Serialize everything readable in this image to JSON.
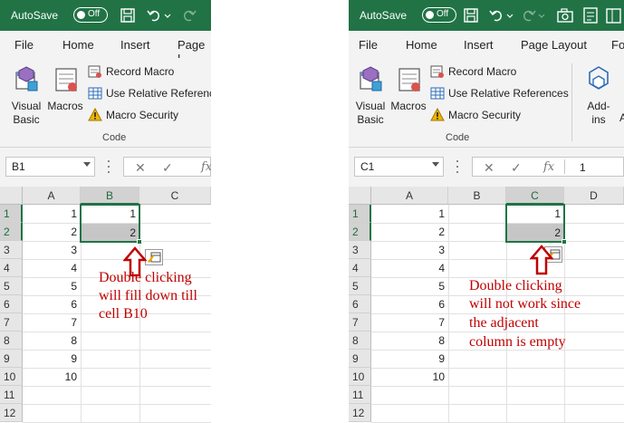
{
  "left": {
    "titlebar": {
      "autosave_label": "AutoSave",
      "toggle_state": "Off"
    },
    "tabs": [
      "File",
      "Home",
      "Insert",
      "Page L"
    ],
    "ribbon": {
      "visual_basic": [
        "Visual",
        "Basic"
      ],
      "macros": "Macros",
      "record_macro": "Record Macro",
      "relative_refs": "Use Relative References",
      "macro_security": "Macro Security",
      "group_label": "Code"
    },
    "formula_bar": {
      "name_box": "B1",
      "fx": "fx"
    },
    "columns": [
      "A",
      "B",
      "C"
    ],
    "rows": [
      "1",
      "2",
      "3",
      "4",
      "5",
      "6",
      "7",
      "8",
      "9",
      "10",
      "11",
      "12"
    ],
    "cells": {
      "col_a": [
        "1",
        "2",
        "3",
        "4",
        "5",
        "6",
        "7",
        "8",
        "9",
        "10"
      ],
      "b1": "1",
      "b2": "2"
    },
    "annotation": [
      "Double clicking",
      "will fill down till",
      "cell B10"
    ]
  },
  "right": {
    "titlebar": {
      "autosave_label": "AutoSave",
      "toggle_state": "Off"
    },
    "tabs": [
      "File",
      "Home",
      "Insert",
      "Page Layout",
      "Fo"
    ],
    "ribbon": {
      "visual_basic": [
        "Visual",
        "Basic"
      ],
      "macros": "Macros",
      "record_macro": "Record Macro",
      "relative_refs": "Use Relative References",
      "macro_security": "Macro Security",
      "group_label": "Code",
      "addins": [
        "Add-",
        "ins"
      ],
      "addins_partial": "A"
    },
    "formula_bar": {
      "name_box": "C1",
      "fx": "fx",
      "value": "1"
    },
    "columns": [
      "A",
      "B",
      "C",
      "D"
    ],
    "rows": [
      "1",
      "2",
      "3",
      "4",
      "5",
      "6",
      "7",
      "8",
      "9",
      "10",
      "11",
      "12"
    ],
    "cells": {
      "col_a": [
        "1",
        "2",
        "3",
        "4",
        "5",
        "6",
        "7",
        "8",
        "9",
        "10"
      ],
      "c1": "1",
      "c2": "2"
    },
    "annotation": [
      "Double clicking",
      "will not work since",
      "the adjacent",
      "column is empty"
    ]
  },
  "colors": {
    "excel_green": "#217346",
    "annotation_red": "#c00000",
    "ribbon_bg": "#f3f3f3"
  },
  "icons": [
    "save-icon",
    "undo-icon",
    "redo-icon",
    "camera-icon",
    "form-icon",
    "visual-basic-icon",
    "macros-icon",
    "record-macro-icon",
    "relative-references-icon",
    "macro-security-icon",
    "add-ins-icon",
    "cancel-icon",
    "enter-icon",
    "quick-analysis-icon"
  ]
}
